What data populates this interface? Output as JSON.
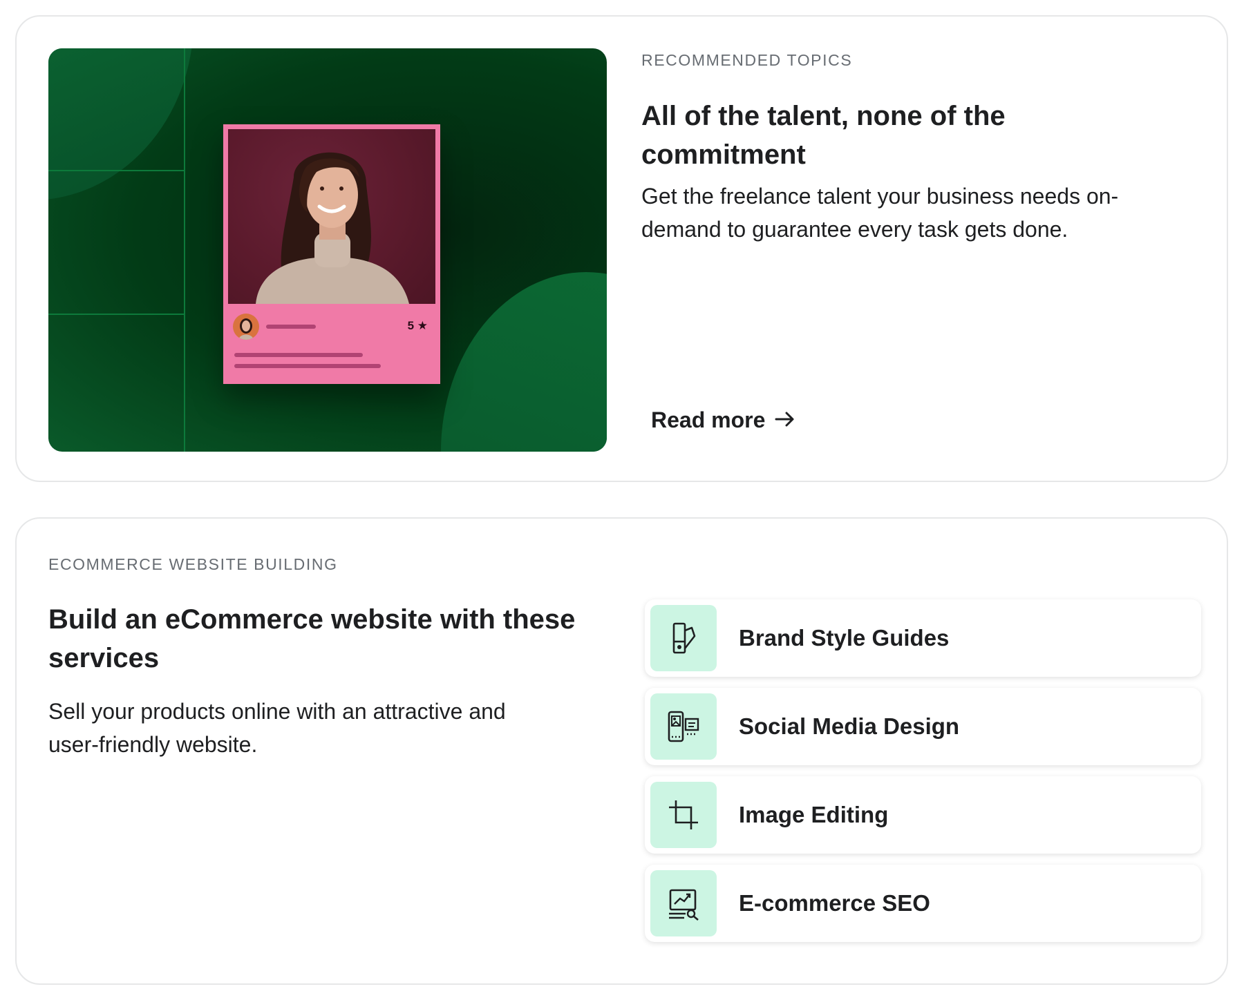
{
  "recommended": {
    "eyebrow": "RECOMMENDED TOPICS",
    "headline_line1": "All of the talent, none of the",
    "headline_line2": "commitment",
    "body_line1": "Get the freelance talent your business needs on-",
    "body_line2": "demand to guarantee every task gets done.",
    "read_more_label": "Read more",
    "read_more_arrow": "→",
    "profile_rating": "5 ★"
  },
  "ecommerce": {
    "eyebrow": "ECOMMERCE WEBSITE BUILDING",
    "headline_line1": "Build an eCommerce website with these",
    "headline_line2": "services",
    "body_line1": "Sell your products online with an attractive and",
    "body_line2": "user-friendly website.",
    "services": [
      {
        "label": "Brand Style Guides",
        "icon": "brand-style-guide-icon"
      },
      {
        "label": "Social Media Design",
        "icon": "social-media-design-icon"
      },
      {
        "label": "Image Editing",
        "icon": "crop-icon"
      },
      {
        "label": "E-commerce SEO",
        "icon": "seo-analytics-icon"
      }
    ]
  },
  "colors": {
    "hero_green": "#023b16",
    "profile_pink": "#f07aa7",
    "icon_tile_mint": "#ccf5e3",
    "eyebrow_gray": "#676c72"
  }
}
